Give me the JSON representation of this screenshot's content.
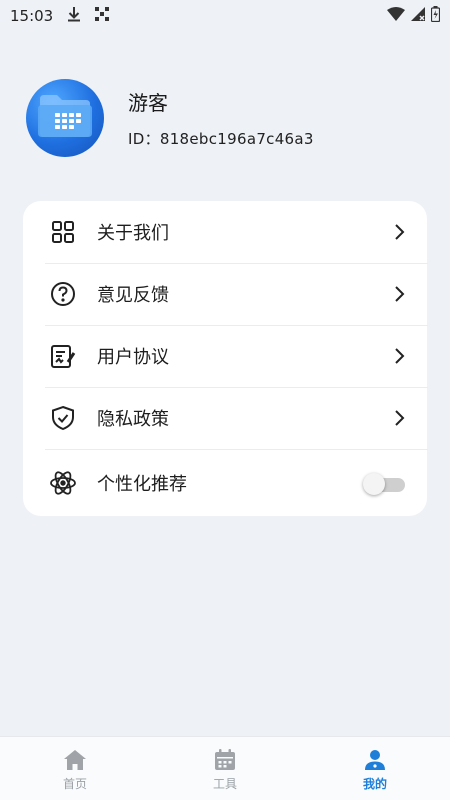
{
  "status_bar": {
    "time": "15:03"
  },
  "profile": {
    "name": "游客",
    "id_text": "ID：818ebc196a7c46a3"
  },
  "menu": {
    "items": [
      {
        "label": "关于我们",
        "icon": "grid-apps-icon"
      },
      {
        "label": "意见反馈",
        "icon": "help-circle-icon"
      },
      {
        "label": "用户协议",
        "icon": "document-edit-icon"
      },
      {
        "label": "隐私政策",
        "icon": "shield-check-icon"
      },
      {
        "label": "个性化推荐",
        "icon": "atom-icon",
        "toggle": false
      }
    ]
  },
  "bottom_nav": {
    "items": [
      {
        "label": "首页",
        "icon": "home-icon",
        "active": false
      },
      {
        "label": "工具",
        "icon": "calendar-tools-icon",
        "active": false
      },
      {
        "label": "我的",
        "icon": "user-icon",
        "active": true
      }
    ]
  },
  "colors": {
    "background": "#eef2f6",
    "card": "#ffffff",
    "accent": "#1f7fd8",
    "inactive_nav": "#9aa0a6"
  }
}
